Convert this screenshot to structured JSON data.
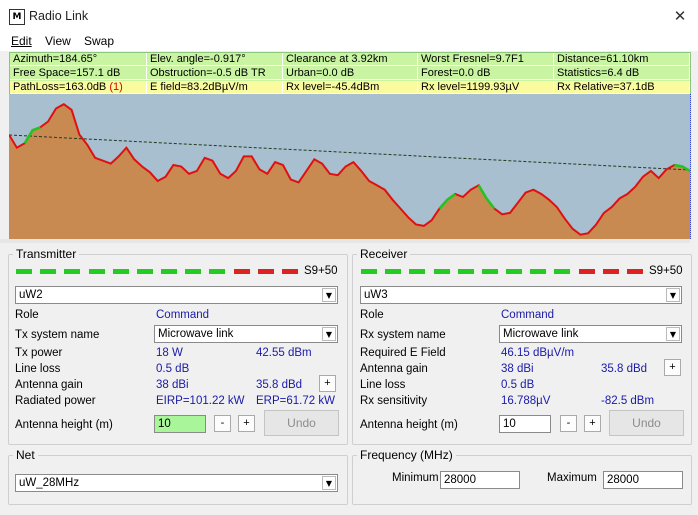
{
  "window": {
    "title": "Radio Link",
    "icon_glyph": "M"
  },
  "menu": [
    {
      "label": "Edit"
    },
    {
      "label": "View"
    },
    {
      "label": "Swap"
    }
  ],
  "info": {
    "rows": [
      [
        "Azimuth=184.65°",
        "Elev. angle=-0.917°",
        "Clearance at 3.92km",
        "Worst Fresnel=9.7F1",
        "Distance=61.10km"
      ],
      [
        "Free Space=157.1 dB",
        "Obstruction=-0.5 dB TR",
        "Urban=0.0 dB",
        "Forest=0.0 dB",
        "Statistics=6.4 dB"
      ],
      [
        "PathLoss=163.0dB",
        "E field=83.2dBµV/m",
        "Rx level=-45.4dBm",
        "Rx level=1199.93µV",
        "Rx Relative=37.1dB"
      ]
    ],
    "pathloss_flag": "(1)"
  },
  "transmitter": {
    "title": "Transmitter",
    "signal_label": "S9+50",
    "station": "uW2",
    "role_label": "Role",
    "role_value": "Command",
    "system_label": "Tx system name",
    "system_value": "Microwave link",
    "power_label": "Tx power",
    "power_w": "18 W",
    "power_dbm": "42.55 dBm",
    "lineloss_label": "Line loss",
    "lineloss_value": "0.5 dB",
    "gain_label": "Antenna gain",
    "gain_dbi": "38 dBi",
    "gain_dbd": "35.8 dBd",
    "plus": "+",
    "radiated_label": "Radiated power",
    "eirp": "EIRP=101.22 kW",
    "erp": "ERP=61.72 kW",
    "height_label": "Antenna height (m)",
    "height_value": "10",
    "minus": "-",
    "undo": "Undo"
  },
  "receiver": {
    "title": "Receiver",
    "signal_label": "S9+50",
    "station": "uW3",
    "role_label": "Role",
    "role_value": "Command",
    "system_label": "Rx system name",
    "system_value": "Microwave link",
    "efield_label": "Required E Field",
    "efield_value": "46.15 dBµV/m",
    "gain_label": "Antenna gain",
    "gain_dbi": "38 dBi",
    "gain_dbd": "35.8 dBd",
    "plus": "+",
    "lineloss_label": "Line loss",
    "lineloss_value": "0.5 dB",
    "sens_label": "Rx sensitivity",
    "sens_uv": "16.788µV",
    "sens_dbm": "-82.5 dBm",
    "height_label": "Antenna height (m)",
    "height_value": "10",
    "minus": "-",
    "undo": "Undo"
  },
  "net": {
    "title": "Net",
    "value": "uW_28MHz"
  },
  "frequency": {
    "title": "Frequency (MHz)",
    "min_label": "Minimum",
    "min_value": "28000",
    "max_label": "Maximum",
    "max_value": "28000"
  },
  "colors": {
    "info_bg": "#c9f5a2",
    "info_selected": "#fafa9e",
    "sky": "#a7bfcf",
    "terrain": "#c98a52",
    "terrain_line": "#e01010",
    "clear_line": "#22c422",
    "meter_green": "#22cc22",
    "meter_red": "#dd2222",
    "blue_value": "#1a1aa8"
  },
  "signal_meter": {
    "segments": 12,
    "green_segments": 9
  },
  "terrain_profile": {
    "elevation_fraction": [
      0.72,
      0.63,
      0.66,
      0.75,
      0.77,
      0.81,
      0.9,
      0.93,
      0.89,
      0.72,
      0.65,
      0.56,
      0.54,
      0.52,
      0.57,
      0.63,
      0.55,
      0.5,
      0.46,
      0.4,
      0.43,
      0.51,
      0.5,
      0.45,
      0.47,
      0.56,
      0.54,
      0.45,
      0.42,
      0.47,
      0.57,
      0.57,
      0.48,
      0.45,
      0.53,
      0.51,
      0.41,
      0.39,
      0.47,
      0.55,
      0.52,
      0.45,
      0.44,
      0.5,
      0.53,
      0.47,
      0.4,
      0.37,
      0.34,
      0.27,
      0.21,
      0.15,
      0.1,
      0.09,
      0.13,
      0.21,
      0.27,
      0.31,
      0.29,
      0.34,
      0.37,
      0.28,
      0.21,
      0.17,
      0.18,
      0.25,
      0.32,
      0.34,
      0.31,
      0.27,
      0.22,
      0.14,
      0.07,
      0.03,
      0.04,
      0.1,
      0.18,
      0.22,
      0.28,
      0.31,
      0.36,
      0.43,
      0.47,
      0.42,
      0.48,
      0.51,
      0.5,
      0.47
    ],
    "clear_segments": [
      [
        2,
        4
      ],
      [
        55,
        57
      ],
      [
        60,
        62
      ],
      [
        85,
        87
      ]
    ]
  }
}
